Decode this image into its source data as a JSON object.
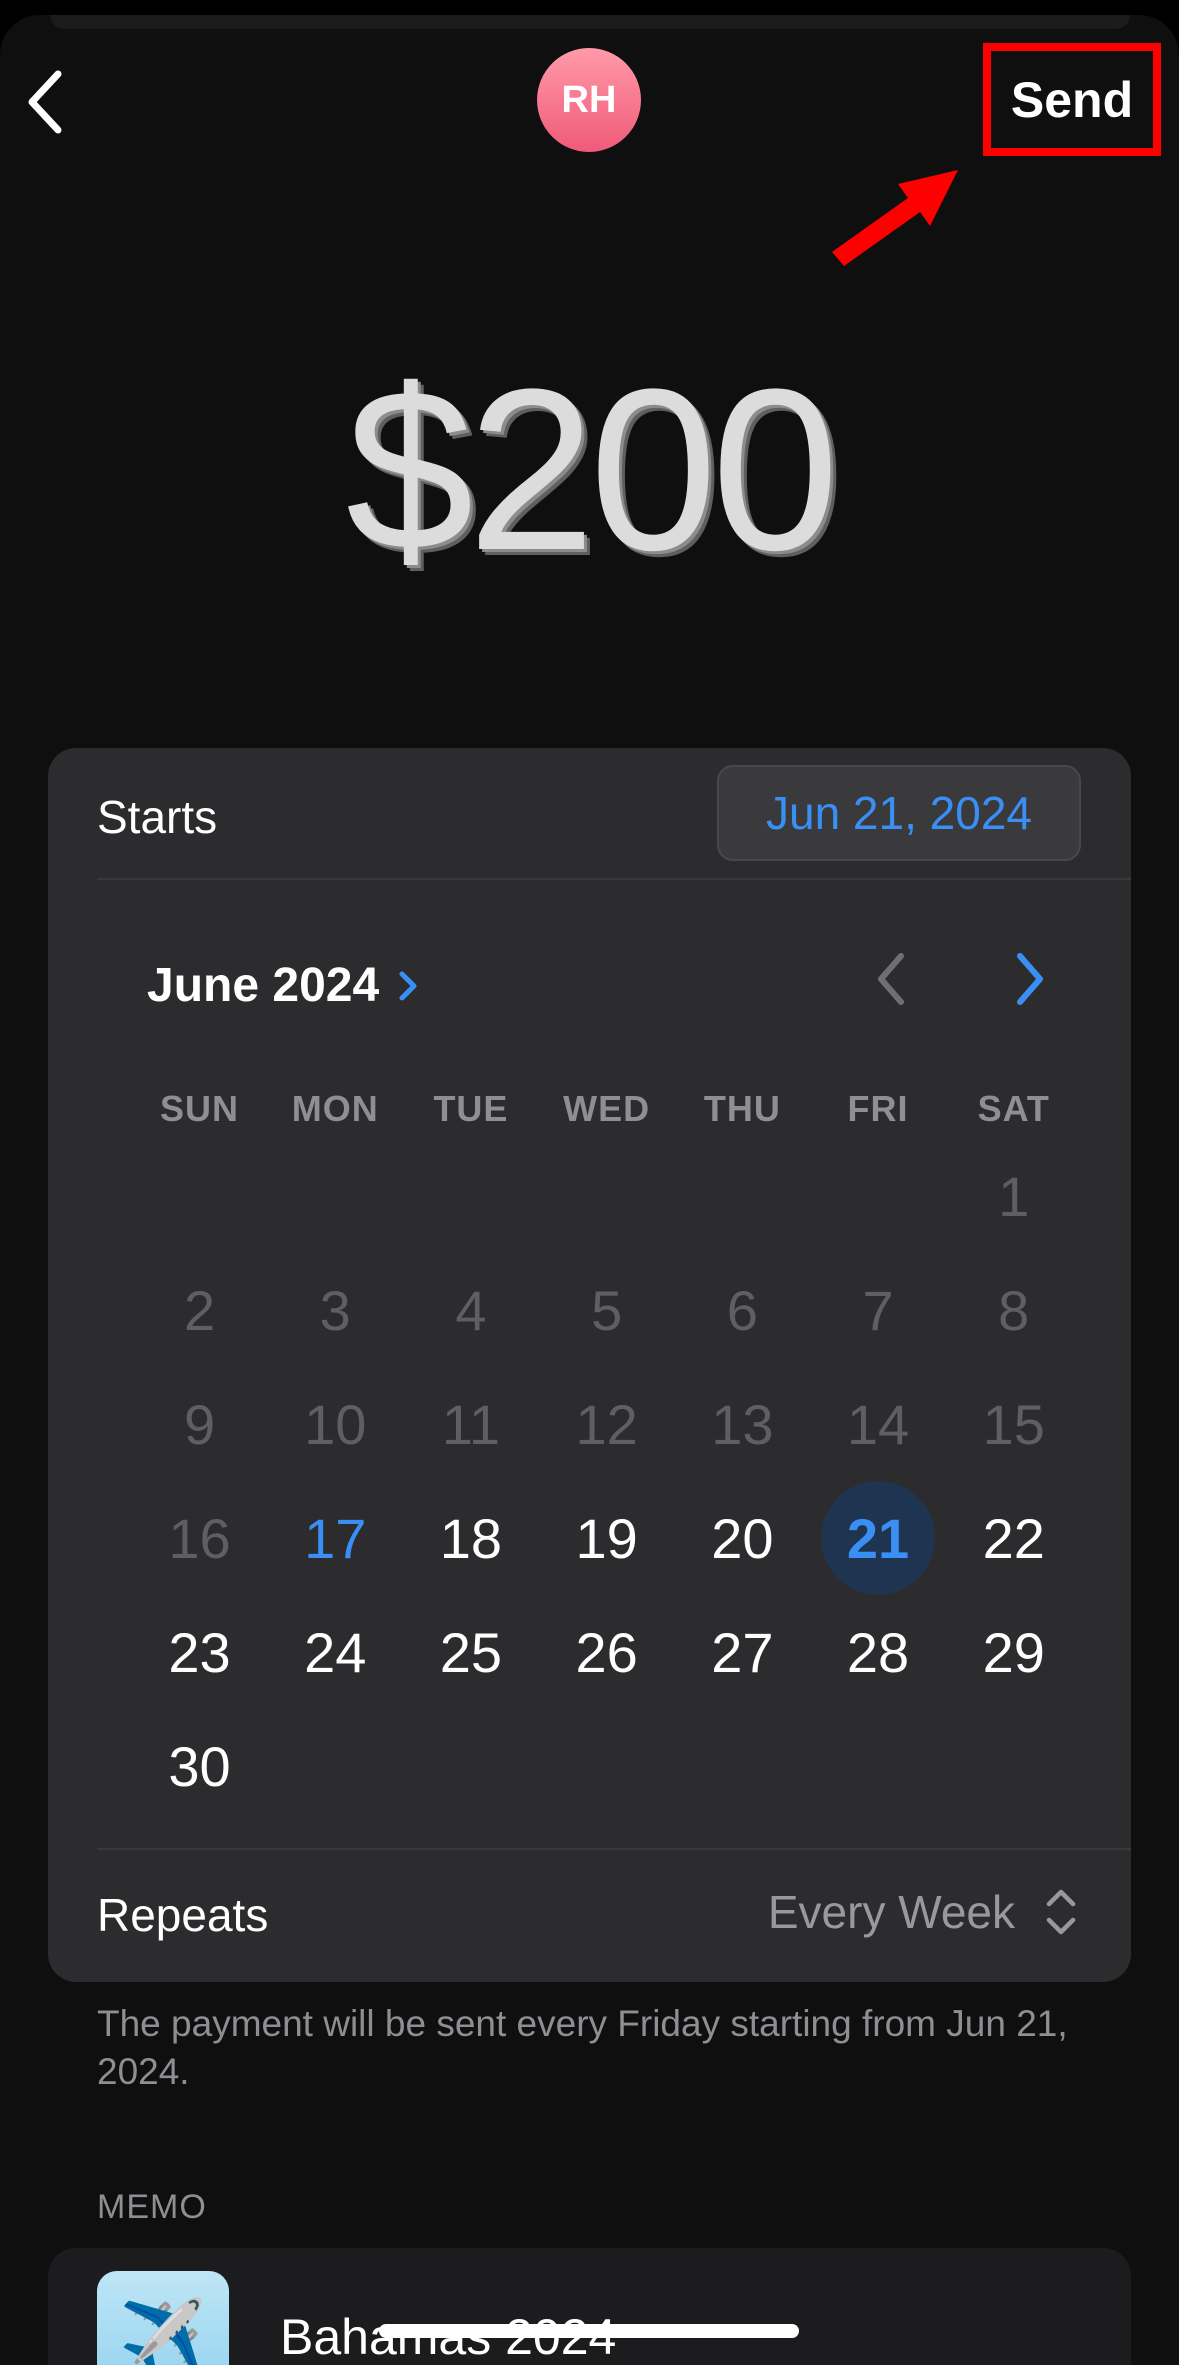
{
  "header": {
    "avatar_initials": "RH",
    "send_label": "Send"
  },
  "amount": "$200",
  "schedule": {
    "starts_label": "Starts",
    "start_date": "Jun 21, 2024",
    "month_title": "June 2024",
    "weekdays": [
      "SUN",
      "MON",
      "TUE",
      "WED",
      "THU",
      "FRI",
      "SAT"
    ],
    "days": [
      {
        "d": "1",
        "state": "past"
      },
      {
        "d": "2",
        "state": "past"
      },
      {
        "d": "3",
        "state": "past"
      },
      {
        "d": "4",
        "state": "past"
      },
      {
        "d": "5",
        "state": "past"
      },
      {
        "d": "6",
        "state": "past"
      },
      {
        "d": "7",
        "state": "past"
      },
      {
        "d": "8",
        "state": "past"
      },
      {
        "d": "9",
        "state": "past"
      },
      {
        "d": "10",
        "state": "past"
      },
      {
        "d": "11",
        "state": "past"
      },
      {
        "d": "12",
        "state": "past"
      },
      {
        "d": "13",
        "state": "past"
      },
      {
        "d": "14",
        "state": "past"
      },
      {
        "d": "15",
        "state": "past"
      },
      {
        "d": "16",
        "state": "past"
      },
      {
        "d": "17",
        "state": "today"
      },
      {
        "d": "18",
        "state": "future"
      },
      {
        "d": "19",
        "state": "future"
      },
      {
        "d": "20",
        "state": "future"
      },
      {
        "d": "21",
        "state": "selected"
      },
      {
        "d": "22",
        "state": "future"
      },
      {
        "d": "23",
        "state": "future"
      },
      {
        "d": "24",
        "state": "future"
      },
      {
        "d": "25",
        "state": "future"
      },
      {
        "d": "26",
        "state": "future"
      },
      {
        "d": "27",
        "state": "future"
      },
      {
        "d": "28",
        "state": "future"
      },
      {
        "d": "29",
        "state": "future"
      },
      {
        "d": "30",
        "state": "future"
      }
    ],
    "repeats_label": "Repeats",
    "repeats_value": "Every Week"
  },
  "footnote": "The payment will be sent every Friday starting from Jun 21, 2024.",
  "memo": {
    "label": "MEMO",
    "icon": "airplane-emoji",
    "text": "Bahamas 2024"
  },
  "colors": {
    "accent": "#3a8ff5",
    "annotation": "#ff0000"
  }
}
